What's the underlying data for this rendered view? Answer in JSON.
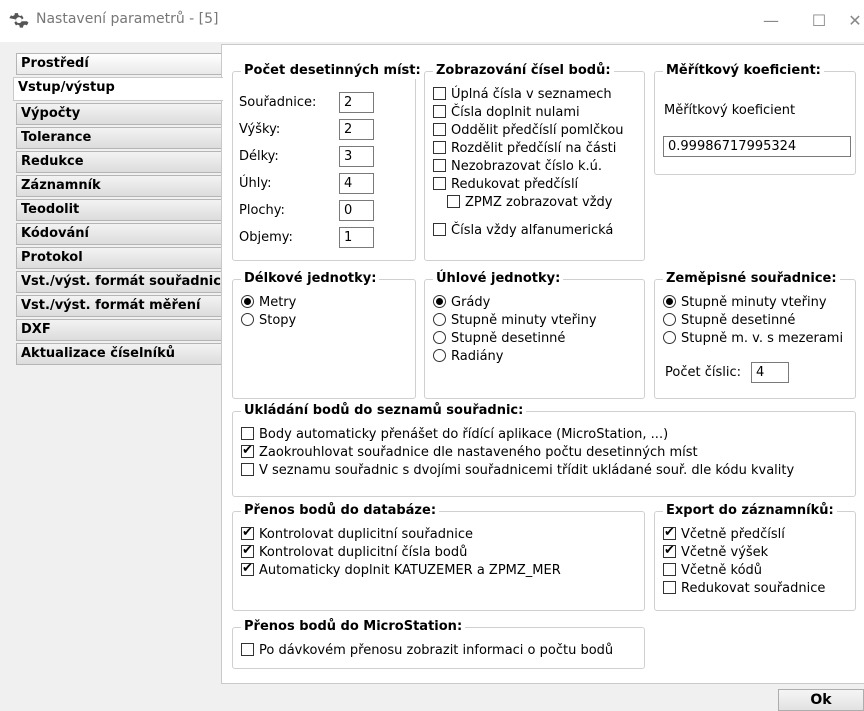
{
  "window": {
    "title": "Nastavení parametrů - [5]",
    "minimize": "—",
    "maximize": "☐",
    "close": "✕",
    "icon": "gear-icon"
  },
  "tabs": [
    "Prostředí",
    "Vstup/výstup",
    "Výpočty",
    "Tolerance",
    "Redukce",
    "Záznamník",
    "Teodolit",
    "Kódování",
    "Protokol",
    "Vst./výst. formát souřadnic",
    "Vst./výst. formát měření",
    "DXF",
    "Aktualizace číselníků"
  ],
  "active_tab": "Vstup/výstup",
  "decimals": {
    "title": "Počet desetinných míst:",
    "items": [
      {
        "label": "Souřadnice:",
        "value": "2"
      },
      {
        "label": "Výšky:",
        "value": "2"
      },
      {
        "label": "Délky:",
        "value": "3"
      },
      {
        "label": "Úhly:",
        "value": "4"
      },
      {
        "label": "Plochy:",
        "value": "0"
      },
      {
        "label": "Objemy:",
        "value": "1"
      }
    ]
  },
  "point_display": {
    "title": "Zobrazování čísel bodů:",
    "items": [
      {
        "label": "Úplná čísla v seznamech",
        "checked": false
      },
      {
        "label": "Čísla doplnit nulami",
        "checked": false
      },
      {
        "label": "Oddělit předčíslí pomlčkou",
        "checked": false
      },
      {
        "label": "Rozdělit předčíslí na části",
        "checked": false
      },
      {
        "label": "Nezobrazovat číslo k.ú.",
        "checked": false
      },
      {
        "label": "Redukovat předčíslí",
        "checked": false
      },
      {
        "label": "ZPMZ zobrazovat vždy",
        "checked": false
      },
      {
        "label": "Čísla vždy alfanumerická",
        "checked": false
      }
    ]
  },
  "scale": {
    "title": "Měřítkový koeficient:",
    "label": "Měřítkový koeficient",
    "value": "0.99986717995324"
  },
  "length_units": {
    "title": "Délkové jednotky:",
    "items": [
      {
        "label": "Metry",
        "checked": true
      },
      {
        "label": "Stopy",
        "checked": false
      }
    ]
  },
  "angle_units": {
    "title": "Úhlové jednotky:",
    "items": [
      {
        "label": "Grády",
        "checked": true
      },
      {
        "label": "Stupně minuty vteřiny",
        "checked": false
      },
      {
        "label": "Stupně desetinné",
        "checked": false
      },
      {
        "label": "Radiány",
        "checked": false
      }
    ]
  },
  "geo_coords": {
    "title": "Zeměpisné souřadnice:",
    "items": [
      {
        "label": "Stupně minuty vteřiny",
        "checked": true
      },
      {
        "label": "Stupně desetinné",
        "checked": false
      },
      {
        "label": "Stupně m. v. s mezerami",
        "checked": false
      }
    ],
    "digits_label": "Počet číslic:",
    "digits_value": "4"
  },
  "saving": {
    "title": "Ukládání bodů do seznamů souřadnic:",
    "items": [
      {
        "label": "Body automaticky přenášet do řídící aplikace (MicroStation, ...)",
        "checked": false
      },
      {
        "label": "Zaokrouhlovat souřadnice dle nastaveného počtu desetinných míst",
        "checked": true
      },
      {
        "label": "V seznamu souřadnic s dvojími souřadnicemi třídit ukládané souř. dle kódu kvality",
        "checked": false
      }
    ]
  },
  "db_transfer": {
    "title": "Přenos bodů do databáze:",
    "items": [
      {
        "label": "Kontrolovat duplicitní souřadnice",
        "checked": true
      },
      {
        "label": "Kontrolovat duplicitní čísla bodů",
        "checked": true
      },
      {
        "label": "Automaticky doplnit KATUZEMER a ZPMZ_MER",
        "checked": true
      }
    ]
  },
  "export": {
    "title": "Export do záznamníků:",
    "items": [
      {
        "label": "Včetně předčíslí",
        "checked": true
      },
      {
        "label": "Včetně výšek",
        "checked": true
      },
      {
        "label": "Včetně kódů",
        "checked": false
      },
      {
        "label": "Redukovat souřadnice",
        "checked": false
      }
    ]
  },
  "ms_transfer": {
    "title": "Přenos bodů do MicroStation:",
    "items": [
      {
        "label": "Po dávkovém přenosu zobrazit informaci o počtu bodů",
        "checked": false
      }
    ]
  },
  "buttons": {
    "ok": "Ok"
  }
}
